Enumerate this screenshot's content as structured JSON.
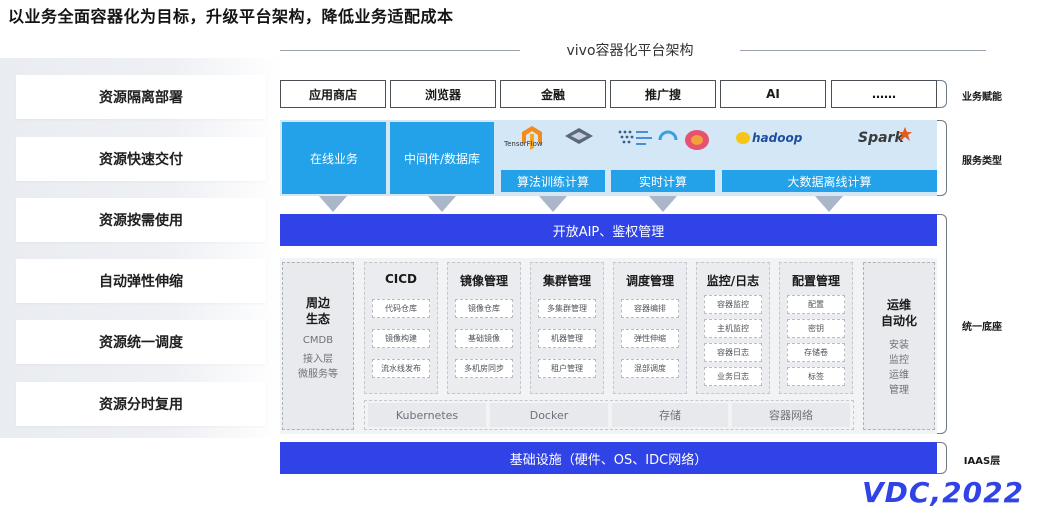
{
  "headline": "以业务全面容器化为目标，升级平台架构，降低业务适配成本",
  "left_captions": [
    "资源隔离部署",
    "资源快速交付",
    "资源按需使用",
    "自动弹性伸缩",
    "资源统一调度",
    "资源分时复用"
  ],
  "arch_title": "vivo容器化平台架构",
  "business": [
    "应用商店",
    "浏览器",
    "金融",
    "推广搜",
    "AI",
    "……"
  ],
  "services": {
    "online": "在线业务",
    "middleware": "中间件/数据库",
    "algo": "算法训练计算",
    "realtime": "实时计算",
    "bigdata": "大数据离线计算",
    "logos": {
      "tensorflow": "TensorFlow",
      "spark": "Spark",
      "hadoop": "hadoop"
    }
  },
  "open_api": "开放AIP、鉴权管理",
  "ecosystem": {
    "title": [
      "周边",
      "生态"
    ],
    "items": [
      "CMDB",
      "接入层",
      "微服务等"
    ]
  },
  "modules": [
    {
      "title": "CICD",
      "items": [
        "代码仓库",
        "镜像构建",
        "流水线发布"
      ]
    },
    {
      "title": "镜像管理",
      "items": [
        "镜像仓库",
        "基础镜像",
        "多机房同步"
      ]
    },
    {
      "title": "集群管理",
      "items": [
        "多集群管理",
        "机器管理",
        "租户管理"
      ]
    },
    {
      "title": "调度管理",
      "items": [
        "容器编排",
        "弹性伸缩",
        "混部调度"
      ]
    },
    {
      "title": "监控/日志",
      "items": [
        "容器监控",
        "主机监控",
        "容器日志",
        "业务日志"
      ]
    },
    {
      "title": "配置管理",
      "items": [
        "配置",
        "密钥",
        "存储卷",
        "标签"
      ]
    }
  ],
  "base_row": [
    "Kubernetes",
    "Docker",
    "存储",
    "容器网络"
  ],
  "ops": {
    "title": [
      "运维",
      "自动化"
    ],
    "items": [
      "安装",
      "监控",
      "运维",
      "管理"
    ]
  },
  "infra": "基础设施（硬件、OS、IDC网络）",
  "right_labels": {
    "biz": "业务赋能",
    "svc": "服务类型",
    "base": "统一底座",
    "iaas": "IAAS层"
  },
  "brand": "VDC,2022",
  "colors": {
    "primary_blue": "#2f43e6",
    "sky_blue": "#23a2ea",
    "panel_blue": "#d3e7f6"
  }
}
